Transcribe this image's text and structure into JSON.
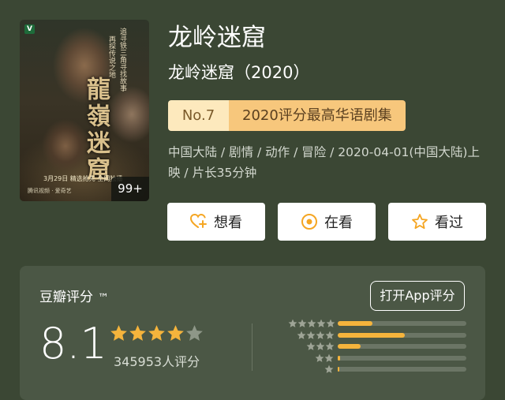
{
  "poster": {
    "title_art": "龍嶺迷窟",
    "logo": "V",
    "side_text": "追寻铁三角寻找故事",
    "side_text2": "再探传说之地",
    "bottom_text": "3月29日 精选抢先 全网独播",
    "bottom_text2": "腾讯视频 · 爱奇艺",
    "badge": "99+"
  },
  "header": {
    "title": "龙岭迷窟",
    "subtitle": "龙岭迷窟（2020）"
  },
  "rank": {
    "number": "No.7",
    "description": "2020评分最高华语剧集"
  },
  "meta": "中国大陆 / 剧情 / 动作 / 冒险 / 2020-04-01(中国大陆)上映 / 片长35分钟",
  "actions": [
    {
      "label": "想看",
      "icon": "heart-plus-icon"
    },
    {
      "label": "在看",
      "icon": "eye-circle-icon"
    },
    {
      "label": "看过",
      "icon": "star-outline-icon"
    }
  ],
  "rating": {
    "title": "豆瓣评分",
    "trademark": "™",
    "app_button": "打开App评分",
    "score": "8.1",
    "stars": 4,
    "votes": "345953人评分",
    "distribution": [
      {
        "stars": 5,
        "fraction": 0.27
      },
      {
        "stars": 4,
        "fraction": 0.52
      },
      {
        "stars": 3,
        "fraction": 0.18
      },
      {
        "stars": 2,
        "fraction": 0.02
      },
      {
        "stars": 1,
        "fraction": 0.01
      }
    ]
  },
  "colors": {
    "background": "#3b4734",
    "card": "#4b5745",
    "star": "#f5b43c",
    "rank_no_bg": "#fde9bd",
    "rank_desc_bg": "#f7c77c",
    "icon_accent": "#f5a623"
  }
}
